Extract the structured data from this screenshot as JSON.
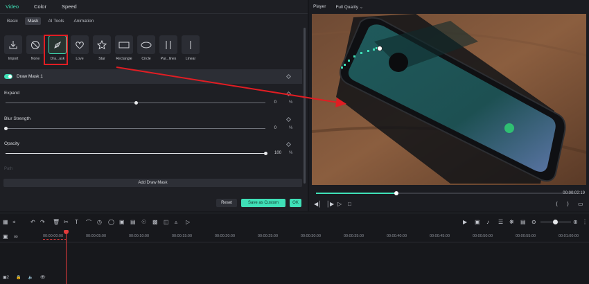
{
  "panel": {
    "main_tabs": [
      "Video",
      "Color",
      "Speed"
    ],
    "sub_tabs": [
      "Basic",
      "Mask",
      "AI Tools",
      "Animation"
    ],
    "shapes": [
      "Import",
      "None",
      "Dra...ask",
      "Love",
      "Star",
      "Rectangle",
      "Circle",
      "Par...lines",
      "Linear"
    ],
    "mask_item": "Draw Mask 1",
    "params": {
      "expand": {
        "label": "Expand",
        "value": "0",
        "unit": "%",
        "level": 0.5
      },
      "blur": {
        "label": "Blur Strength",
        "value": "0",
        "unit": "%",
        "level": 0.0
      },
      "opacity": {
        "label": "Opacity",
        "value": "100",
        "unit": "%",
        "level": 1.0
      }
    },
    "faded_label": "Path",
    "add_button": "Add Draw Mask",
    "buttons": {
      "reset": "Reset",
      "save_custom": "Save as Custom",
      "ok": "OK"
    }
  },
  "player": {
    "label": "Player",
    "quality": "Full Quality",
    "time": "00:00:02:19",
    "progress": 0.31
  },
  "timeline": {
    "ticks": [
      "00:00:00:00",
      "00:00:05:00",
      "00:00:10:00",
      "00:00:15:00",
      "00:00:20:00",
      "00:00:25:00",
      "00:00:30:00",
      "00:00:35:00",
      "00:00:40:00",
      "00:00:45:00",
      "00:00:50:00",
      "00:00:55:00",
      "00:01:00:00"
    ],
    "track_count": "2"
  },
  "colors": {
    "accent": "#3fe0b7",
    "highlight": "#e11d23",
    "playhead": "#e23b3b"
  }
}
